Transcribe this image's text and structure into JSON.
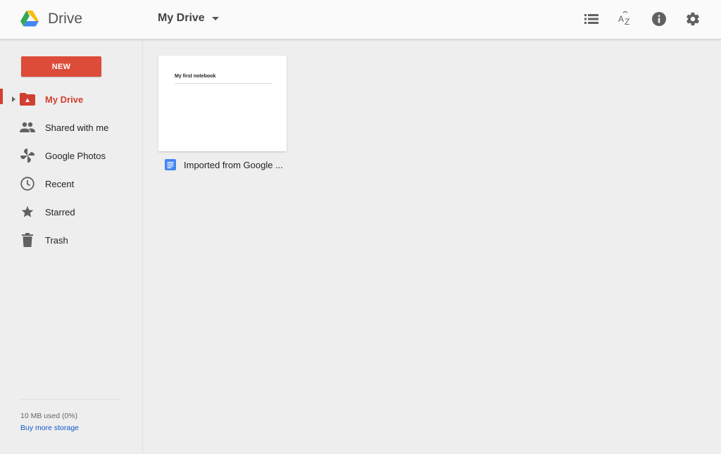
{
  "header": {
    "app_name": "Drive",
    "breadcrumb": "My Drive",
    "tools": [
      "list-view-icon",
      "sort-az-icon",
      "info-icon",
      "settings-icon"
    ]
  },
  "sidebar": {
    "new_label": "NEW",
    "items": [
      {
        "label": "My Drive",
        "icon": "drive-folder-icon",
        "active": true
      },
      {
        "label": "Shared with me",
        "icon": "people-icon"
      },
      {
        "label": "Google Photos",
        "icon": "photos-pinwheel-icon"
      },
      {
        "label": "Recent",
        "icon": "clock-icon"
      },
      {
        "label": "Starred",
        "icon": "star-icon"
      },
      {
        "label": "Trash",
        "icon": "trash-icon"
      }
    ],
    "storage_text": "10 MB used (0%)",
    "buy_storage": "Buy more storage"
  },
  "files": [
    {
      "thumbnail_title": "My first notebook",
      "name": "Imported from Google ...",
      "icon": "google-docs-icon"
    }
  ],
  "colors": {
    "accent": "#dd4b39",
    "active_nav": "#d23f31",
    "link": "#1155cc",
    "docs_blue": "#4285f4"
  }
}
